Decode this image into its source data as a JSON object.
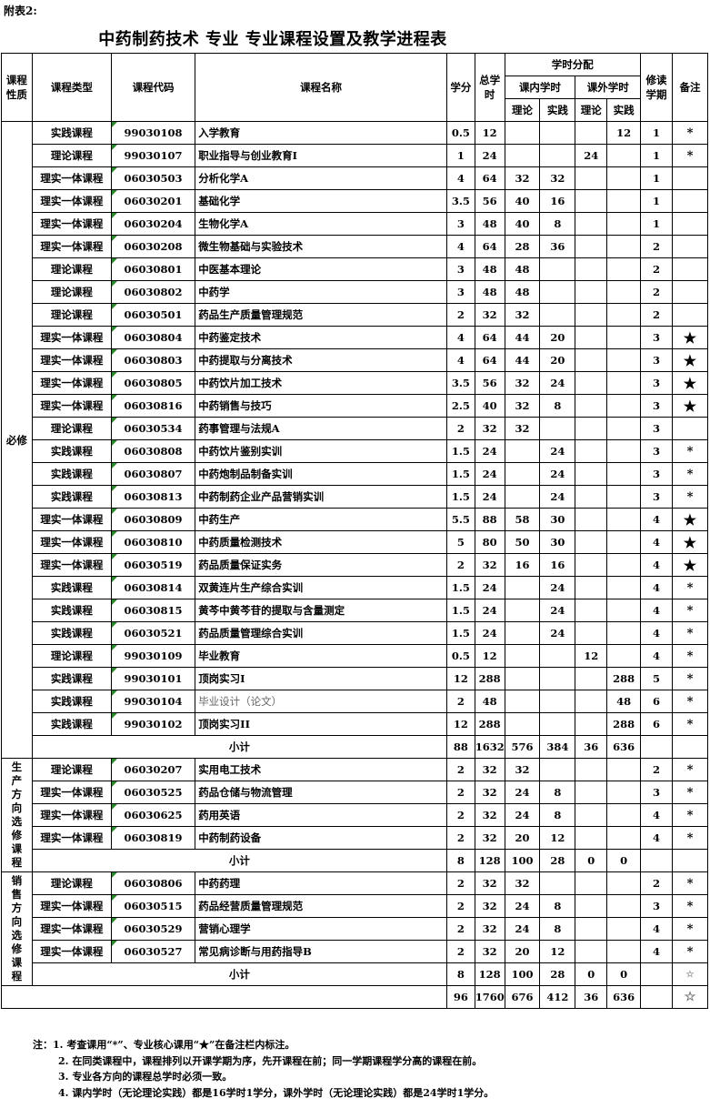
{
  "annex": "附表2:",
  "title": "中药制药技术 专业  专业课程设置及教学进程表",
  "headers": {
    "nature": "课程性质",
    "type": "课程类型",
    "code": "课程代码",
    "name": "课程名称",
    "credit": "学分",
    "total": "总学时",
    "dist": "学时分配",
    "inclass": "课内学时",
    "outclass": "课外学时",
    "theory": "理论",
    "practice": "实践",
    "theory2": "理论",
    "practice2": "实践",
    "semester": "修读学期",
    "remark": "备注"
  },
  "sections": [
    {
      "label": "必修",
      "rows": [
        [
          "实践课程",
          "99030108",
          "入学教育",
          "0.5",
          "12",
          "",
          "",
          "",
          "12",
          "1",
          "*"
        ],
        [
          "理论课程",
          "99030107",
          "职业指导与创业教育I",
          "1",
          "24",
          "",
          "",
          "24",
          "",
          "1",
          "*"
        ],
        [
          "理实一体课程",
          "06030503",
          "分析化学A",
          "4",
          "64",
          "32",
          "32",
          "",
          "",
          "1",
          ""
        ],
        [
          "理实一体课程",
          "06030201",
          "基础化学",
          "3.5",
          "56",
          "40",
          "16",
          "",
          "",
          "1",
          ""
        ],
        [
          "理实一体课程",
          "06030204",
          "生物化学A",
          "3",
          "48",
          "40",
          "8",
          "",
          "",
          "1",
          ""
        ],
        [
          "理实一体课程",
          "06030208",
          "微生物基础与实验技术",
          "4",
          "64",
          "28",
          "36",
          "",
          "",
          "2",
          ""
        ],
        [
          "理论课程",
          "06030801",
          "中医基本理论",
          "3",
          "48",
          "48",
          "",
          "",
          "",
          "2",
          ""
        ],
        [
          "理论课程",
          "06030802",
          "中药学",
          "3",
          "48",
          "48",
          "",
          "",
          "",
          "2",
          ""
        ],
        [
          "理论课程",
          "06030501",
          "药品生产质量管理规范",
          "2",
          "32",
          "32",
          "",
          "",
          "",
          "2",
          ""
        ],
        [
          "理实一体课程",
          "06030804",
          "中药鉴定技术",
          "4",
          "64",
          "44",
          "20",
          "",
          "",
          "3",
          "★"
        ],
        [
          "理实一体课程",
          "06030803",
          "中药提取与分离技术",
          "4",
          "64",
          "44",
          "20",
          "",
          "",
          "3",
          "★"
        ],
        [
          "理实一体课程",
          "06030805",
          "中药饮片加工技术",
          "3.5",
          "56",
          "32",
          "24",
          "",
          "",
          "3",
          "★"
        ],
        [
          "理实一体课程",
          "06030816",
          "中药销售与技巧",
          "2.5",
          "40",
          "32",
          "8",
          "",
          "",
          "3",
          "★"
        ],
        [
          "理论课程",
          "06030534",
          "药事管理与法规A",
          "2",
          "32",
          "32",
          "",
          "",
          "",
          "3",
          ""
        ],
        [
          "实践课程",
          "06030808",
          "中药饮片鉴别实训",
          "1.5",
          "24",
          "",
          "24",
          "",
          "",
          "3",
          "*"
        ],
        [
          "实践课程",
          "06030807",
          "中药炮制品制备实训",
          "1.5",
          "24",
          "",
          "24",
          "",
          "",
          "3",
          "*"
        ],
        [
          "实践课程",
          "06030813",
          "中药制药企业产品营销实训",
          "1.5",
          "24",
          "",
          "24",
          "",
          "",
          "3",
          "*"
        ],
        [
          "理实一体课程",
          "06030809",
          "中药生产",
          "5.5",
          "88",
          "58",
          "30",
          "",
          "",
          "4",
          "★"
        ],
        [
          "理实一体课程",
          "06030810",
          "中药质量检测技术",
          "5",
          "80",
          "50",
          "30",
          "",
          "",
          "4",
          "★"
        ],
        [
          "理实一体课程",
          "06030519",
          "药品质量保证实务",
          "2",
          "32",
          "16",
          "16",
          "",
          "",
          "4",
          "★"
        ],
        [
          "实践课程",
          "06030814",
          "双黄连片生产综合实训",
          "1.5",
          "24",
          "",
          "24",
          "",
          "",
          "4",
          "*"
        ],
        [
          "实践课程",
          "06030815",
          "黄芩中黄芩苷的提取与含量测定",
          "1.5",
          "24",
          "",
          "24",
          "",
          "",
          "4",
          "*"
        ],
        [
          "实践课程",
          "06030521",
          "药品质量管理综合实训",
          "1.5",
          "24",
          "",
          "24",
          "",
          "",
          "4",
          "*"
        ],
        [
          "理论课程",
          "99030109",
          "毕业教育",
          "0.5",
          "12",
          "",
          "",
          "12",
          "",
          "4",
          "*"
        ],
        [
          "实践课程",
          "99030101",
          "顶岗实习I",
          "12",
          "288",
          "",
          "",
          "",
          "288",
          "5",
          "*"
        ],
        [
          "实践课程",
          "99030104",
          "毕业设计（论文）",
          "2",
          "48",
          "",
          "",
          "",
          "48",
          "6",
          "*"
        ],
        [
          "实践课程",
          "99030102",
          "顶岗实习II",
          "12",
          "288",
          "",
          "",
          "",
          "288",
          "6",
          "*"
        ]
      ],
      "subtotal": [
        "小计",
        "88",
        "1632",
        "576",
        "384",
        "36",
        "636"
      ]
    },
    {
      "label": "生产方向选修课程",
      "rows": [
        [
          "理论课程",
          "06030207",
          "实用电工技术",
          "2",
          "32",
          "32",
          "",
          "",
          "",
          "2",
          "*"
        ],
        [
          "理实一体课程",
          "06030525",
          "药品仓储与物流管理",
          "2",
          "32",
          "24",
          "8",
          "",
          "",
          "3",
          "*"
        ],
        [
          "理实一体课程",
          "06030625",
          "药用英语",
          "2",
          "32",
          "24",
          "8",
          "",
          "",
          "4",
          "*"
        ],
        [
          "理实一体课程",
          "06030819",
          "中药制药设备",
          "2",
          "32",
          "20",
          "12",
          "",
          "",
          "4",
          "*"
        ]
      ],
      "subtotal": [
        "小计",
        "8",
        "128",
        "100",
        "28",
        "0",
        "0"
      ]
    },
    {
      "label": "销售方向选修课程",
      "rows": [
        [
          "理论课程",
          "06030806",
          "中药药理",
          "2",
          "32",
          "32",
          "",
          "",
          "",
          "2",
          "*"
        ],
        [
          "理实一体课程",
          "06030515",
          "药品经营质量管理规范",
          "2",
          "32",
          "24",
          "8",
          "",
          "",
          "3",
          "*"
        ],
        [
          "理实一体课程",
          "06030529",
          "营销心理学",
          "2",
          "32",
          "24",
          "8",
          "",
          "",
          "4",
          "*"
        ],
        [
          "理实一体课程",
          "06030527",
          "常见病诊断与用药指导B",
          "2",
          "32",
          "20",
          "12",
          "",
          "",
          "4",
          "*"
        ]
      ],
      "subtotal": [
        "小计",
        "8",
        "128",
        "100",
        "28",
        "0",
        "0"
      ]
    }
  ],
  "total_row": [
    "96",
    "1760",
    "676",
    "412",
    "36",
    "636"
  ],
  "total_icon": "star-outline-icon",
  "notes": [
    "注：1. 考查课用“*”、专业核心课用“★”在备注栏内标注。",
    "2. 在同类课程中，课程排列以开课学期为序，先开课程在前；同一学期课程学分高的课程在前。",
    "3. 专业各方向的课程总学时必须一致。",
    "4. 课内学时（无论理论实践）都是16学时1学分，课外学时（无论理论实践）都是24学时1学分。"
  ]
}
